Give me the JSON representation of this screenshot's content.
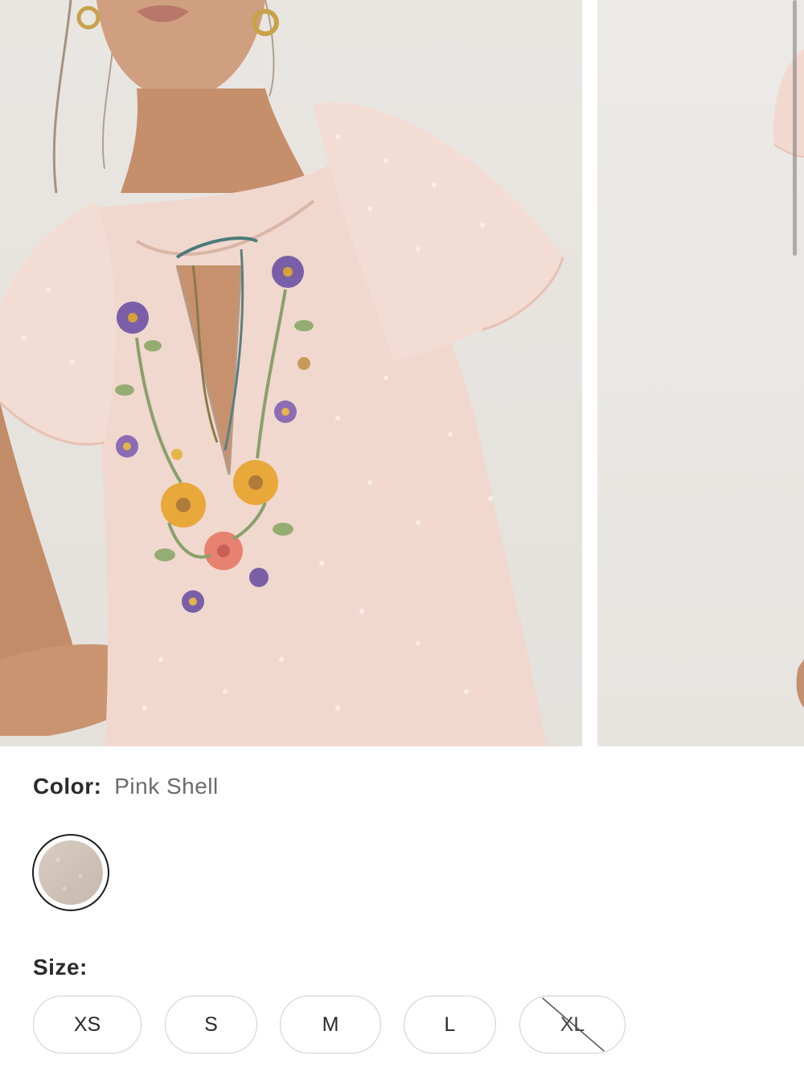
{
  "gallery": {
    "images": [
      {
        "name": "embroidered-dress-front"
      },
      {
        "name": "embroidered-dress-back"
      }
    ]
  },
  "color": {
    "label": "Color:",
    "value": "Pink Shell",
    "swatches": [
      {
        "name": "Pink Shell",
        "selected": true,
        "hex": "#d3c5b9"
      }
    ]
  },
  "size": {
    "label": "Size:",
    "options": [
      {
        "label": "XS",
        "available": true
      },
      {
        "label": "S",
        "available": true
      },
      {
        "label": "M",
        "available": true
      },
      {
        "label": "L",
        "available": true
      },
      {
        "label": "XL",
        "available": false
      }
    ]
  },
  "colors": {
    "dress": "#f1d8cf",
    "skin": "#c89674",
    "text_dark": "#2b2b2b",
    "text_muted": "#6b6b6b",
    "pill_border": "#cfcfcf",
    "swatch_ring": "#1d1d1d"
  }
}
